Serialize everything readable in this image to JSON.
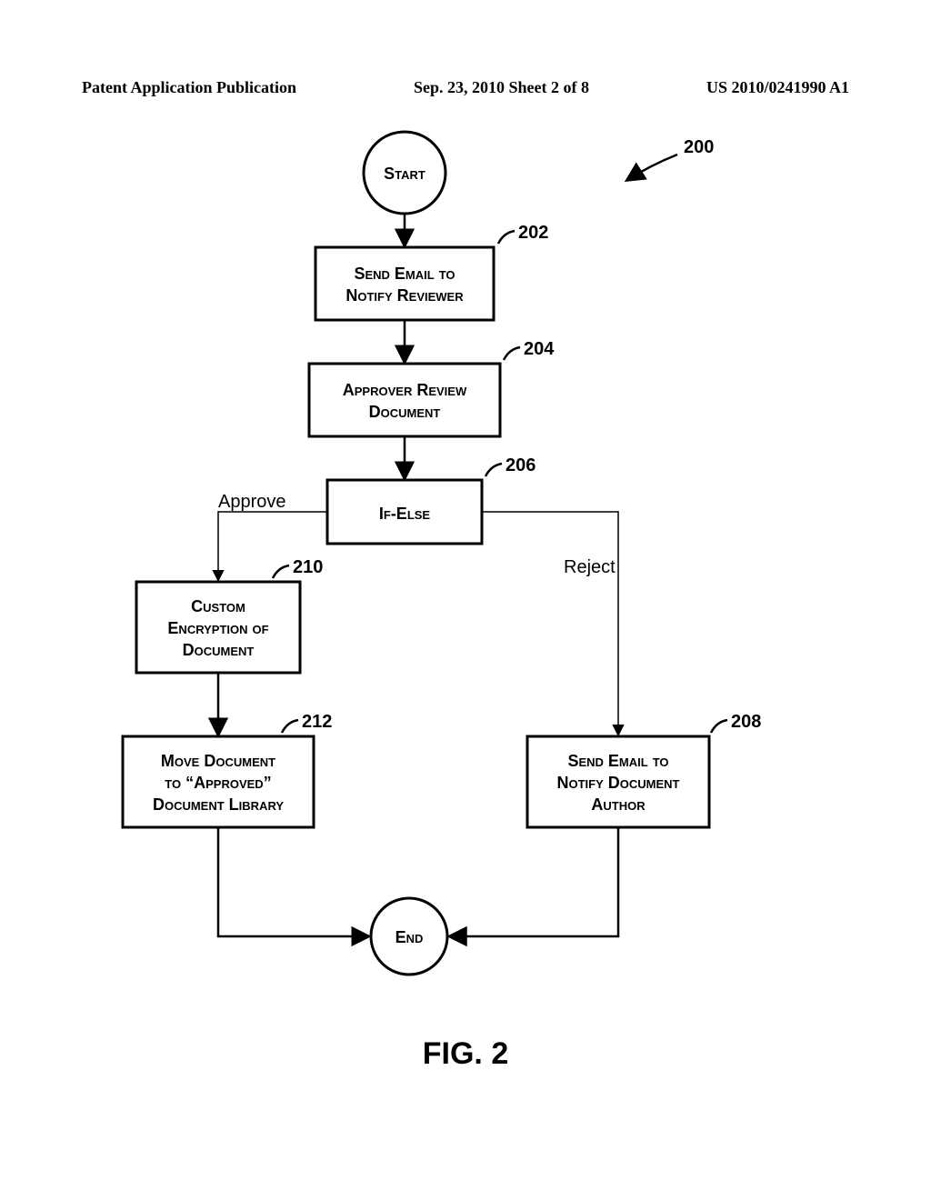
{
  "header": {
    "left": "Patent Application Publication",
    "center": "Sep. 23, 2010  Sheet 2 of 8",
    "right": "US 2010/0241990 A1"
  },
  "figure": {
    "caption": "FIG. 2",
    "ref_main": "200",
    "nodes": {
      "start": "Start",
      "end": "End",
      "n202_l1": "Send Email to",
      "n202_l2": "Notify Reviewer",
      "n204_l1": "Approver Review",
      "n204_l2": "Document",
      "n206": "If-Else",
      "n208_l1": "Send Email to",
      "n208_l2": "Notify Document",
      "n208_l3": "Author",
      "n210_l1": "Custom",
      "n210_l2": "Encryption of",
      "n210_l3": "Document",
      "n212_l1": "Move Document",
      "n212_l2": "to “Approved”",
      "n212_l3": "Document Library"
    },
    "refs": {
      "r202": "202",
      "r204": "204",
      "r206": "206",
      "r208": "208",
      "r210": "210",
      "r212": "212"
    },
    "edges": {
      "approve": "Approve",
      "reject": "Reject"
    }
  }
}
